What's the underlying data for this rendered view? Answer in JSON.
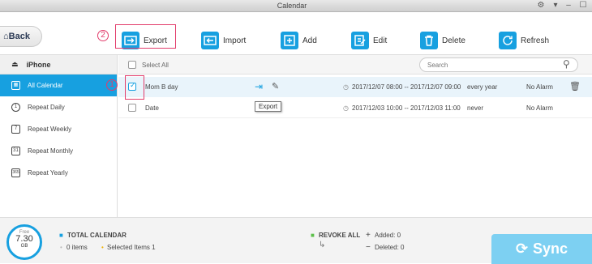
{
  "window": {
    "title": "Calendar"
  },
  "toolbar": {
    "back_label": "Back",
    "buttons": [
      {
        "label": "Export",
        "icon": "export-icon"
      },
      {
        "label": "Import",
        "icon": "import-icon"
      },
      {
        "label": "Add",
        "icon": "add-icon"
      },
      {
        "label": "Edit",
        "icon": "edit-icon"
      },
      {
        "label": "Delete",
        "icon": "trash-icon"
      },
      {
        "label": "Refresh",
        "icon": "refresh-icon"
      }
    ]
  },
  "annotations": {
    "step1": "1",
    "step2": "2"
  },
  "sidebar": {
    "device": "iPhone",
    "items": [
      {
        "label": "All Calendar",
        "icon": "calendar-all-icon",
        "glyph": "▦"
      },
      {
        "label": "Repeat Daily",
        "icon": "repeat-daily-icon",
        "glyph": "1"
      },
      {
        "label": "Repeat Weekly",
        "icon": "repeat-weekly-icon",
        "glyph": "7"
      },
      {
        "label": "Repeat Monthly",
        "icon": "repeat-monthly-icon",
        "glyph": "31"
      },
      {
        "label": "Repeat Yearly",
        "icon": "repeat-yearly-icon",
        "glyph": "365"
      }
    ]
  },
  "list": {
    "select_all": "Select All",
    "search_placeholder": "Search",
    "rows": [
      {
        "name": "Mom  B day",
        "time": "2017/12/07 08:00 -- 2017/12/07 09:00",
        "repeat": "every year",
        "alarm": "No Alarm"
      },
      {
        "name": "Date",
        "time": "2017/12/03 10:00 -- 2017/12/03 11:00",
        "repeat": "never",
        "alarm": "No Alarm"
      }
    ],
    "tooltip": "Export"
  },
  "footer": {
    "storage": {
      "label": "Free",
      "value": "7.30",
      "unit": "GB"
    },
    "total_title": "TOTAL CALENDAR",
    "items": "0 items",
    "selected": "Selected Items 1",
    "revoke_title": "REVOKE ALL",
    "added": "Added: 0",
    "deleted": "Deleted: 0",
    "sync_label": "Sync"
  },
  "colors": {
    "accent": "#17a0e0",
    "highlight": "#e23c6b",
    "sync": "#7dd0f2"
  }
}
